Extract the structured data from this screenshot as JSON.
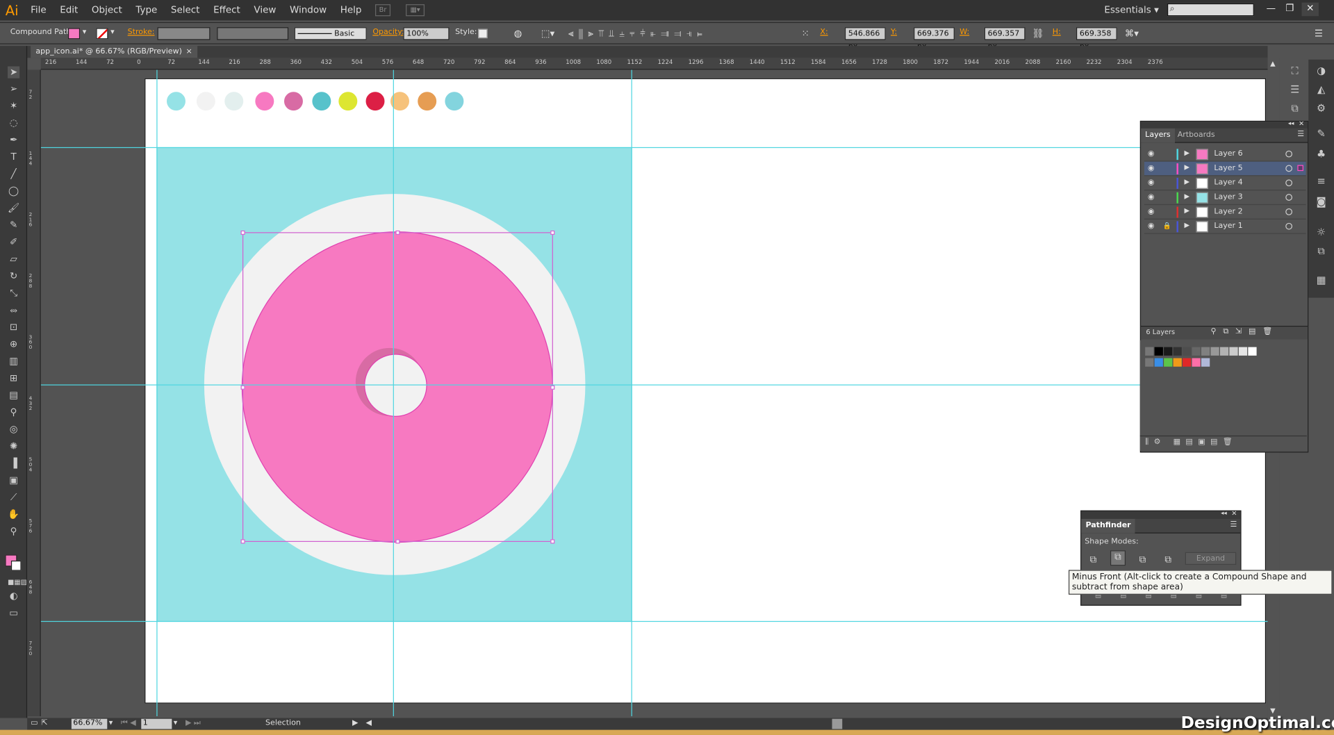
{
  "app": {
    "logo": "Ai"
  },
  "menu": [
    "File",
    "Edit",
    "Object",
    "Type",
    "Select",
    "Effect",
    "View",
    "Window",
    "Help"
  ],
  "workspace": "Essentials",
  "control": {
    "object_type": "Compound Path",
    "stroke_label": "Stroke:",
    "stroke_style": "Basic",
    "opacity_label": "Opacity:",
    "opacity_value": "100%",
    "style_label": "Style:",
    "x_label": "X:",
    "x_value": "546.866 px",
    "y_label": "Y:",
    "y_value": "669.376 px",
    "w_label": "W:",
    "w_value": "669.357 px",
    "h_label": "H:",
    "h_value": "669.358 px",
    "fill_color": "#f779c1"
  },
  "document": {
    "tab_title": "app_icon.ai* @ 66.67% (RGB/Preview)",
    "close": "×"
  },
  "ruler_h": [
    "216",
    "144",
    "72",
    "0",
    "72",
    "144",
    "216",
    "288",
    "360",
    "432",
    "504",
    "576",
    "648",
    "720",
    "792",
    "864",
    "936",
    "1008",
    "1080",
    "1152",
    "1224",
    "1296",
    "1368",
    "1440",
    "1512",
    "1584",
    "1656",
    "1728",
    "1800",
    "1872",
    "1944",
    "2016",
    "2088",
    "2160",
    "2232",
    "2304",
    "2376"
  ],
  "palette_colors": [
    "#95e2e6",
    "#f2f2f2",
    "#e3efee",
    "#f779c1",
    "#d86ba4",
    "#57c2cb",
    "#dde631",
    "#dc1f45",
    "#f6c27b",
    "#e69d53",
    "#83d4de"
  ],
  "artwork": {
    "background": "#95e2e6",
    "outer_circle": "#f2f2f2",
    "donut": "#f779c1",
    "donut_shadow": "#d86ba4",
    "hole": "#f2f2f2"
  },
  "layers_panel": {
    "tabs": [
      "Layers",
      "Artboards"
    ],
    "layers": [
      {
        "name": "Layer 6",
        "color": "#4fd6e0"
      },
      {
        "name": "Layer 5",
        "color": "#ff4fc3"
      },
      {
        "name": "Layer 4",
        "color": "#4a56d8"
      },
      {
        "name": "Layer 3",
        "color": "#4ad84f"
      },
      {
        "name": "Layer 2",
        "color": "#e03030"
      },
      {
        "name": "Layer 1",
        "color": "#4a56d8"
      }
    ],
    "count": "6 Layers"
  },
  "swatch_row1": [
    "#000000",
    "#1a1a1a",
    "#333333",
    "#4d4d4d",
    "#666666",
    "#808080",
    "#999999",
    "#b3b3b3",
    "#cccccc",
    "#e6e6e6",
    "#ffffff"
  ],
  "swatch_row2": [
    "#3a8ee6",
    "#5cc44a",
    "#f09a1a",
    "#e02828",
    "#ff6fa8",
    "#b0b8d8"
  ],
  "pathfinder": {
    "title": "Pathfinder",
    "shape_modes": "Shape Modes:",
    "expand": "Expand",
    "tooltip": "Minus Front (Alt-click to create a Compound Shape and subtract from shape area)"
  },
  "status": {
    "zoom": "66.67%",
    "artboard": "1",
    "tool": "Selection"
  },
  "watermark": "DesignOptimal.com"
}
